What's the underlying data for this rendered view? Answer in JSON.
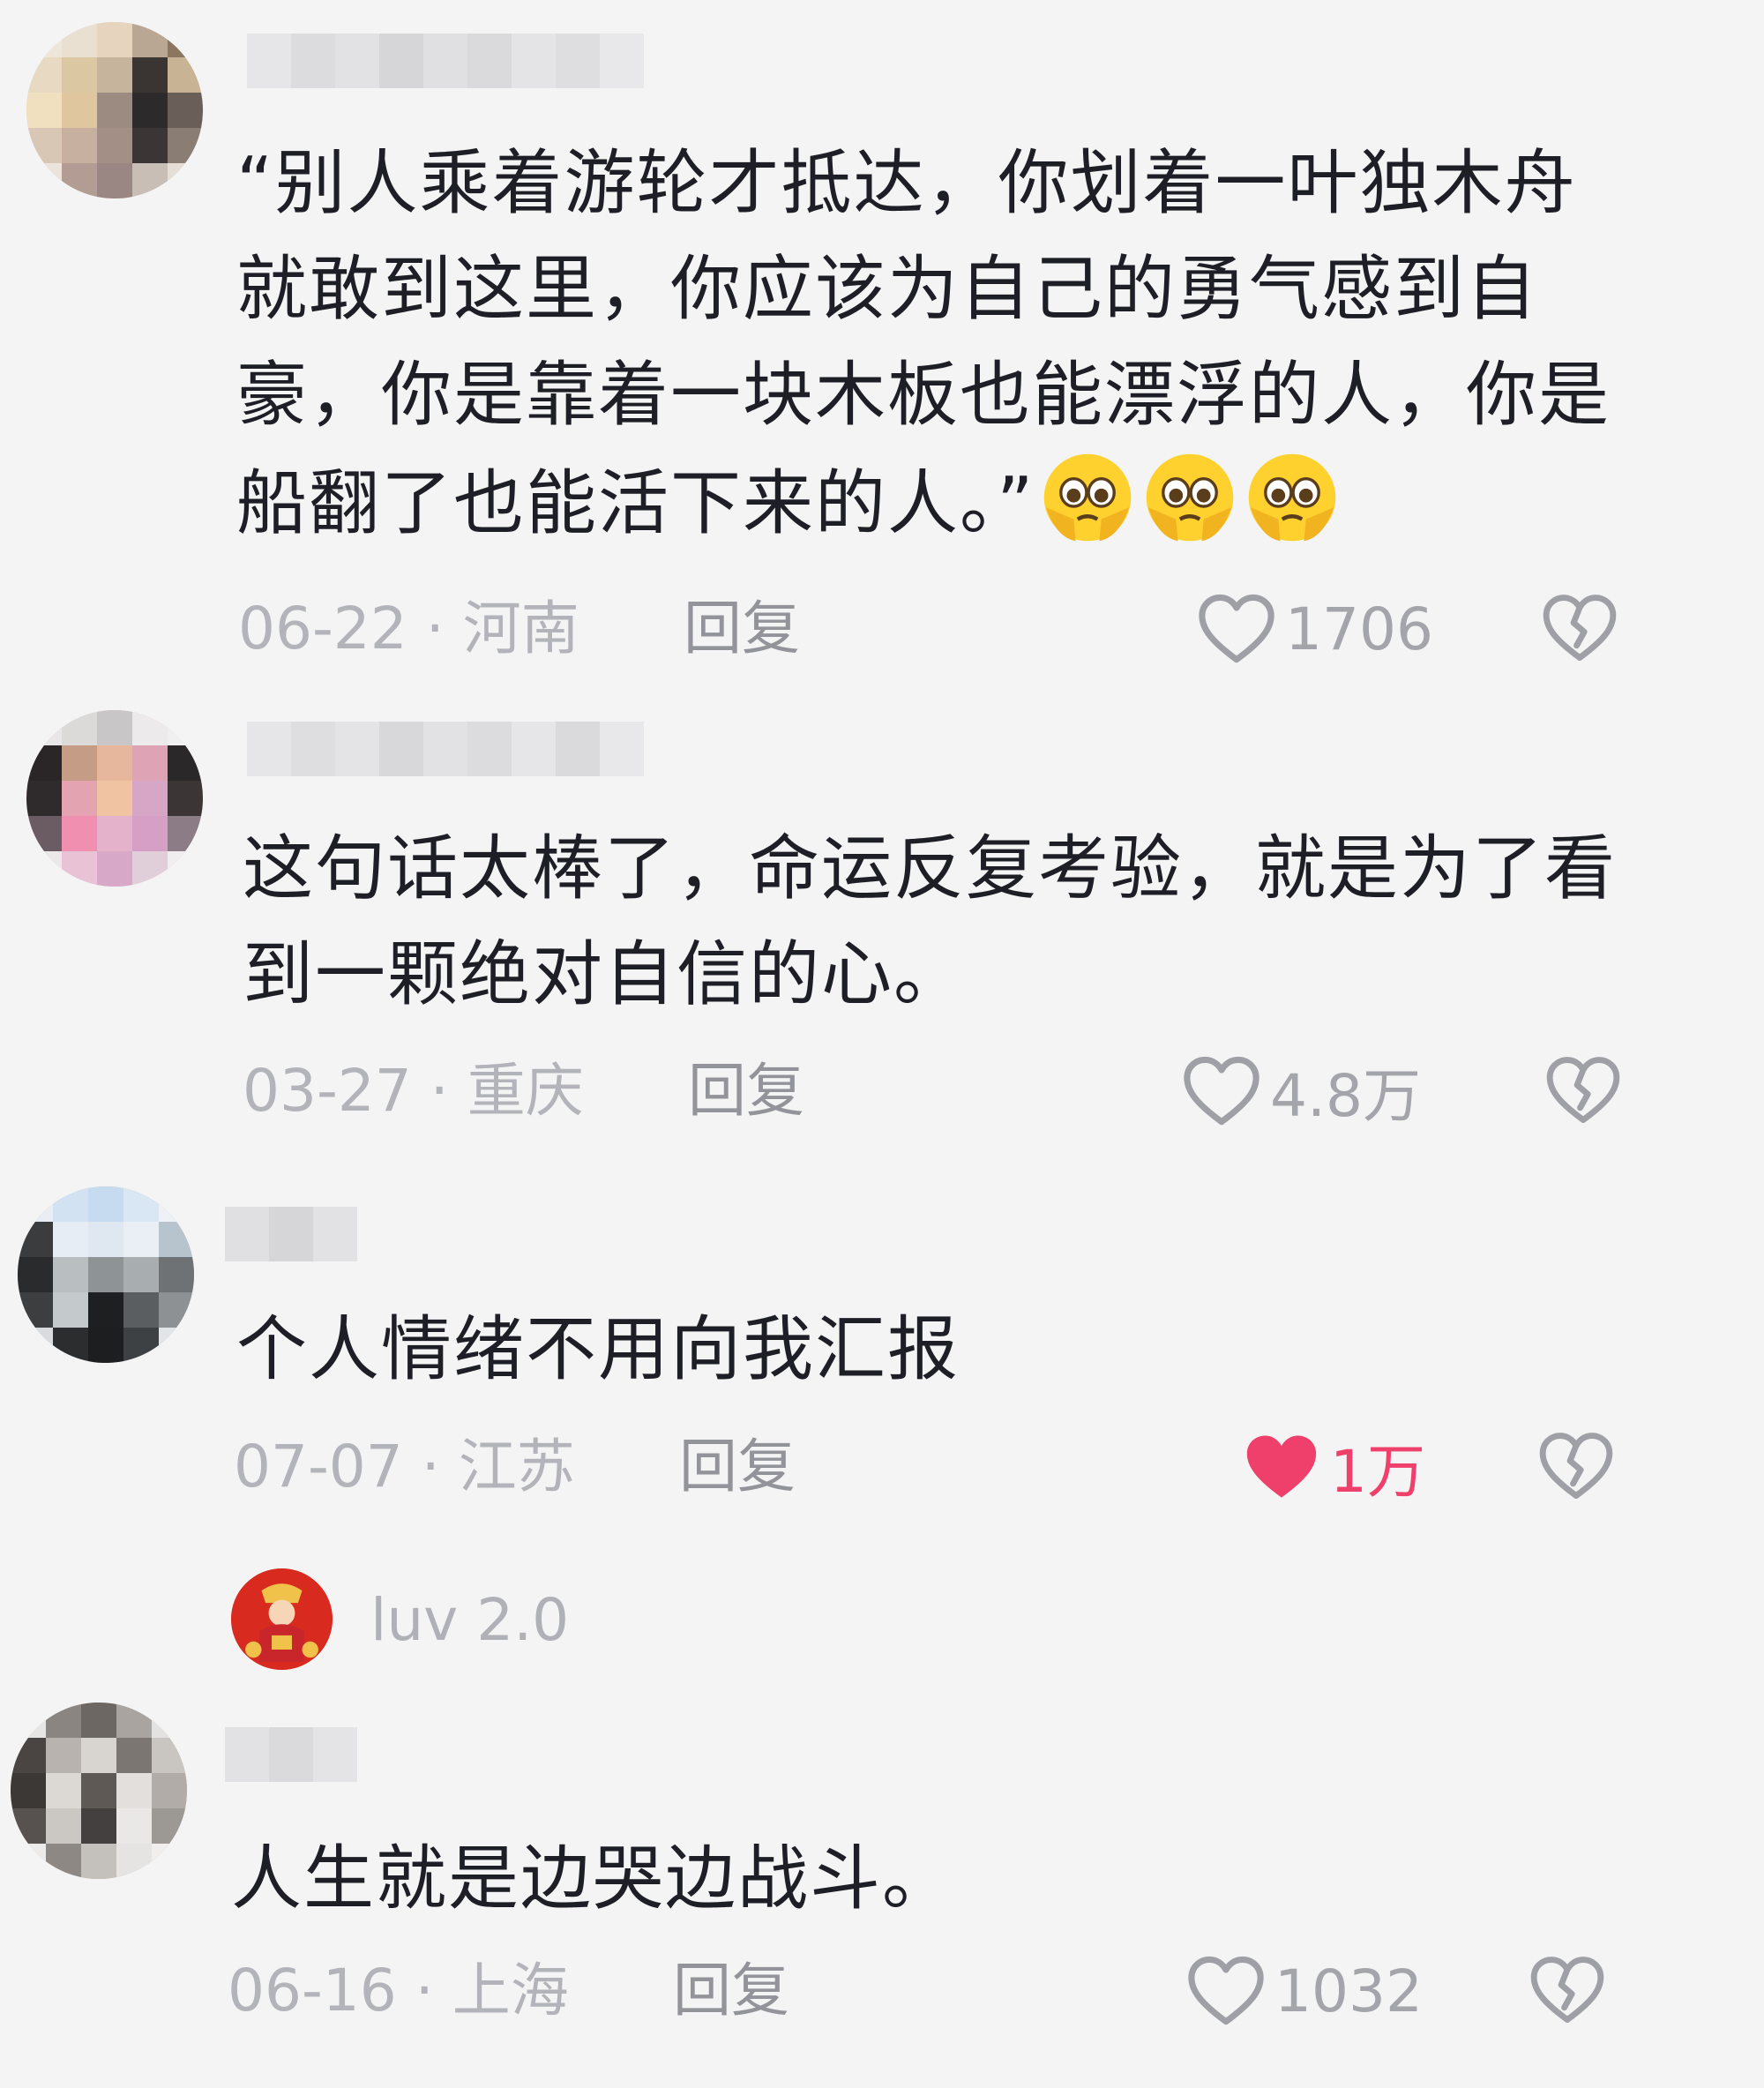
{
  "comments": [
    {
      "text": "“别人乘着游轮才抵达，你划着一叶独木舟就敢到这里，你应该为自己的勇气感到自豪，你是靠着一块木板也能漂浮的人，你是船翻了也能活下来的人。”",
      "emoji": [
        "holding-back-tears-emoji",
        "holding-back-tears-emoji",
        "holding-back-tears-emoji"
      ],
      "date_location": "06-22 · 河南",
      "reply": "回复",
      "likes": "1706",
      "liked": false
    },
    {
      "text": "这句话太棒了，命运反复考验，就是为了看到一颗绝对自信的心。",
      "date_location": "03-27 · 重庆",
      "reply": "回复",
      "likes": "4.8万",
      "liked": false
    },
    {
      "text": "个人情绪不用向我汇报",
      "date_location": "07-07 · 江苏",
      "reply": "回复",
      "likes": "1万",
      "liked": true,
      "reply_preview": {
        "name": "luv 2.0"
      }
    },
    {
      "text": "人生就是边哭边战斗。",
      "date_location": "06-16 · 上海",
      "reply": "回复",
      "likes": "1032",
      "liked": false
    }
  ],
  "colors": {
    "background": "#f4f4f4",
    "text": "#1e1f26",
    "meta": "#b3b4b9",
    "liked_heart": "#ef3f6b",
    "icon_outline": "#9fa0a5"
  }
}
